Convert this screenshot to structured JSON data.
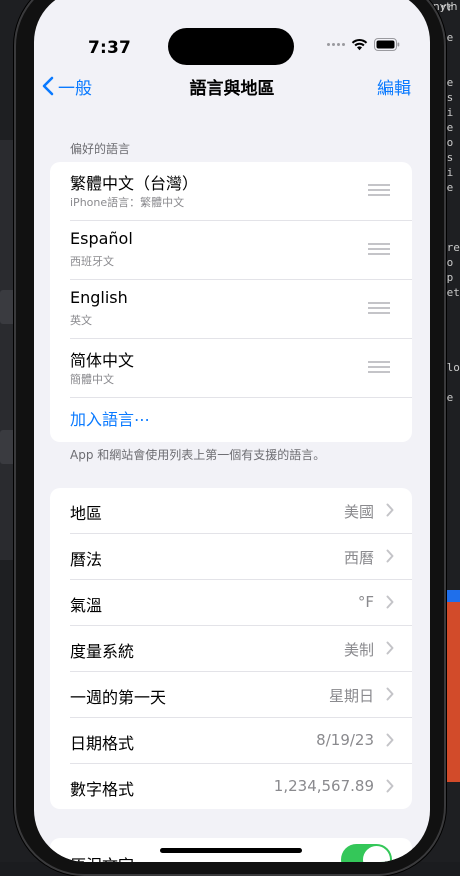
{
  "background": {
    "top_text": "anyth",
    "right_lines": [
      "rr",
      "",
      "pe",
      ":",
      "",
      "re",
      "es",
      "si",
      "be",
      "ro",
      "es",
      "si",
      "be",
      "",
      "",
      "",
      "cre",
      "fo",
      "pp",
      "ret",
      "",
      "",
      "",
      "a",
      "alo",
      "",
      "be"
    ]
  },
  "status_bar": {
    "time": "7:37"
  },
  "nav": {
    "back_label": "一般",
    "title": "語言與地區",
    "edit_label": "編輯"
  },
  "languages_section": {
    "header": "偏好的語言",
    "items": [
      {
        "title": "繁體中文（台灣）",
        "subtitle": "iPhone語言：繁體中文"
      },
      {
        "title": "Español",
        "subtitle": "西班牙文"
      },
      {
        "title": "English",
        "subtitle": "英文"
      },
      {
        "title": "简体中文",
        "subtitle": "簡體中文"
      }
    ],
    "add_label": "加入語言⋯",
    "footer": "App 和網站會使用列表上第一個有支援的語言。"
  },
  "settings_section": {
    "rows": [
      {
        "label": "地區",
        "value": "美國"
      },
      {
        "label": "曆法",
        "value": "西曆"
      },
      {
        "label": "氣溫",
        "value": "°F"
      },
      {
        "label": "度量系統",
        "value": "美制"
      },
      {
        "label": "一週的第一天",
        "value": "星期日"
      },
      {
        "label": "日期格式",
        "value": "8/19/23"
      },
      {
        "label": "數字格式",
        "value": "1,234,567.89"
      }
    ]
  },
  "bottom_row": {
    "label": "原況文字",
    "toggle_on": true
  },
  "colors": {
    "accent": "#0a7aff",
    "toggle": "#34c759",
    "background": "#f2f2f7"
  }
}
